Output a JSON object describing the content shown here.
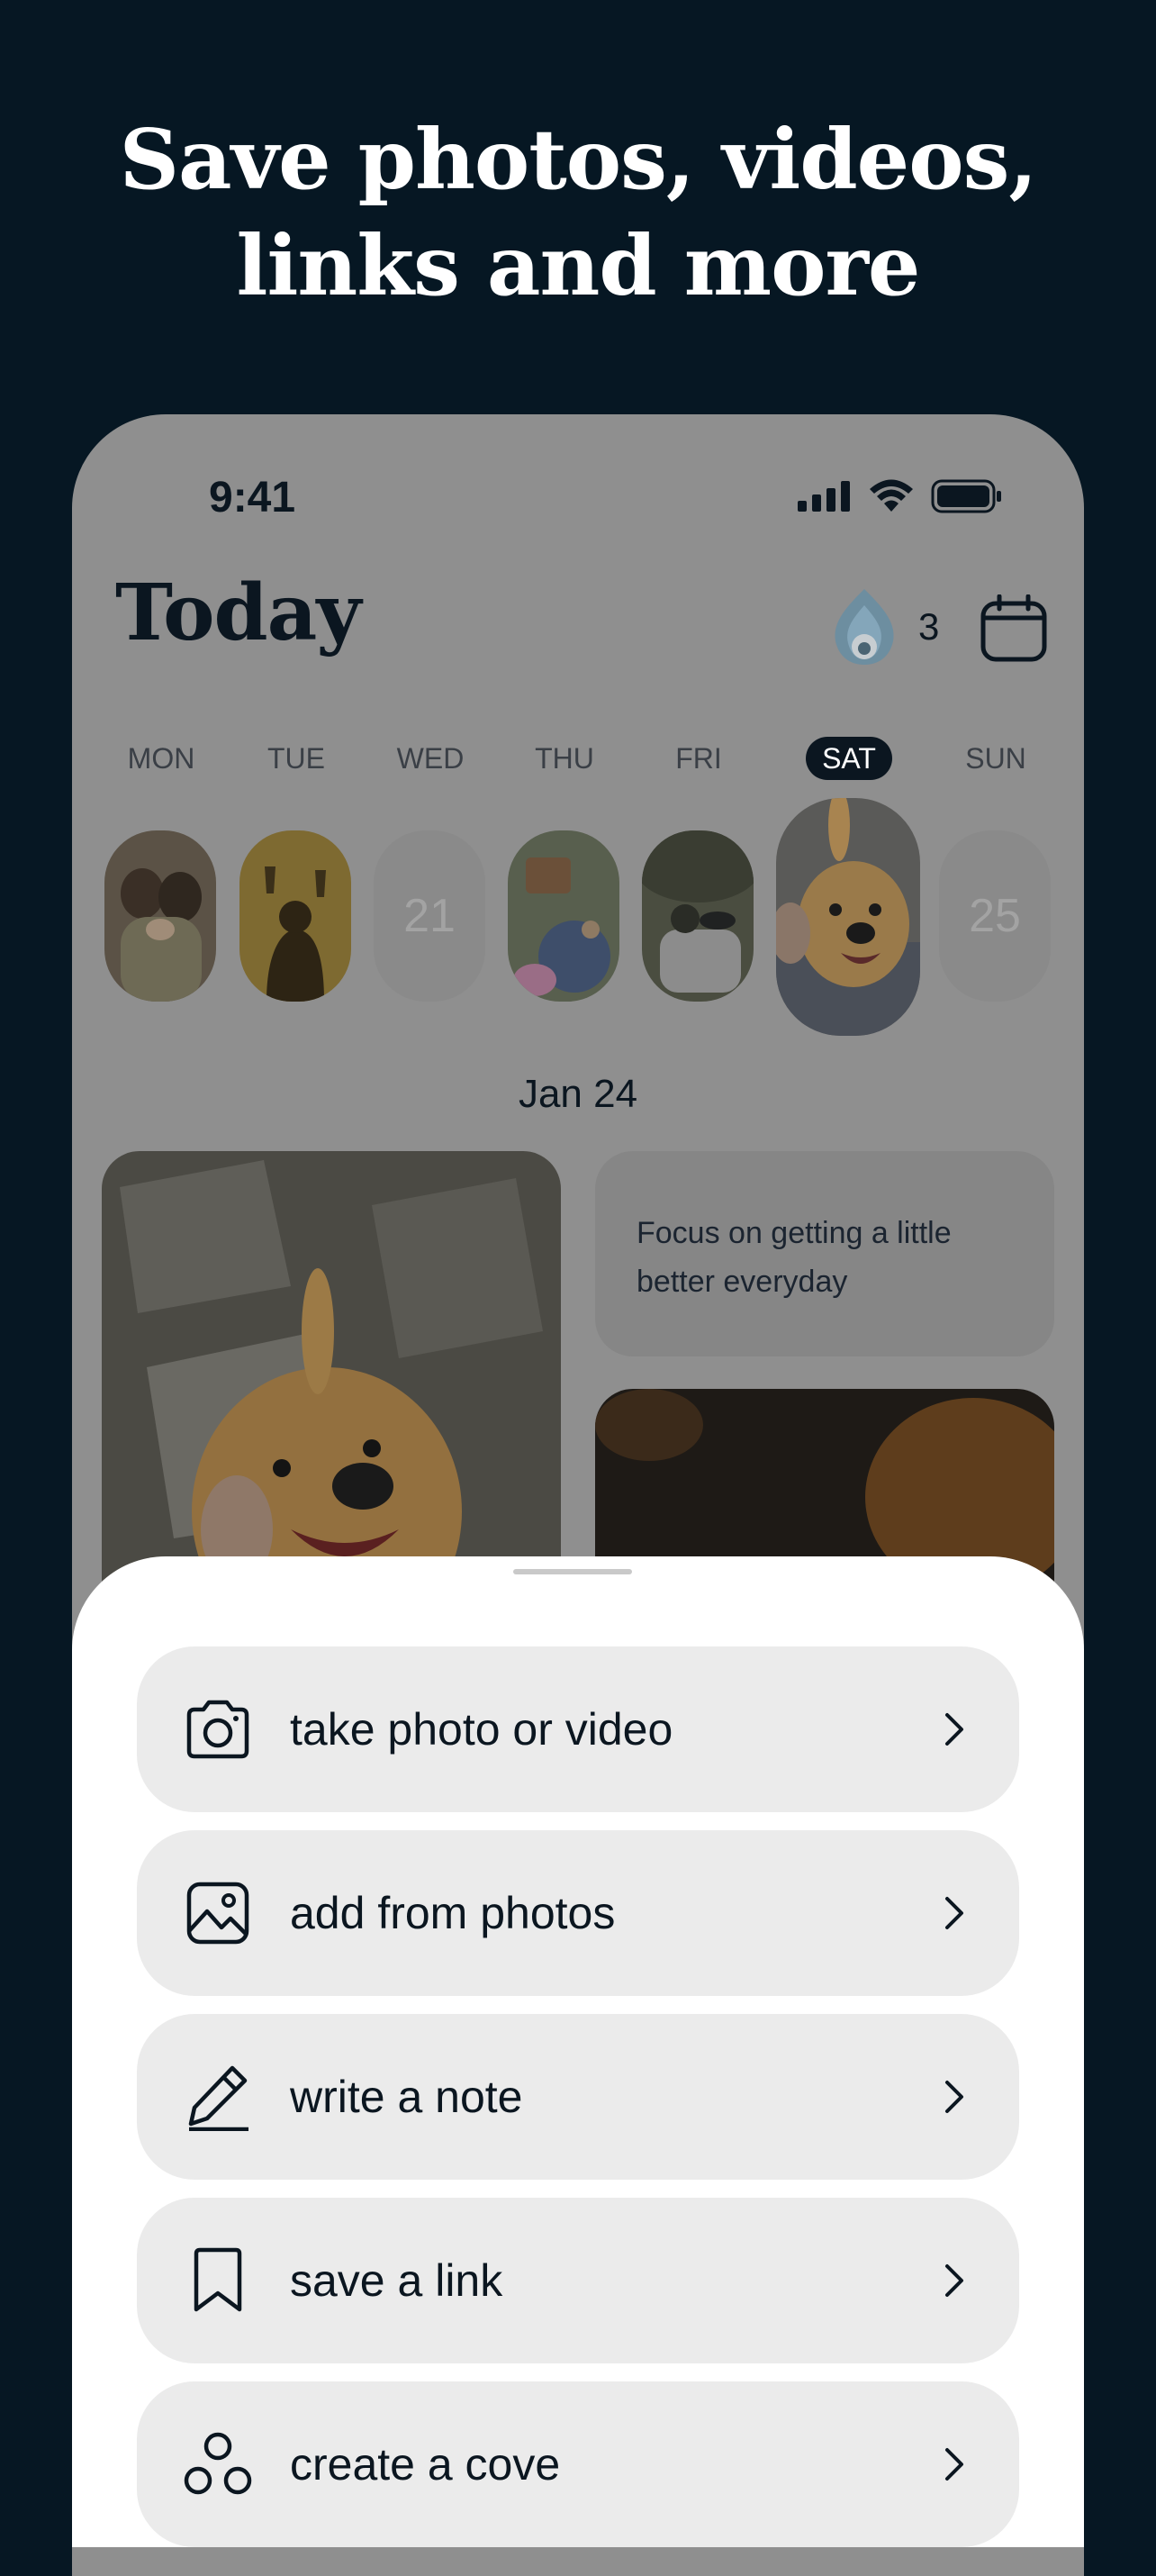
{
  "headline": {
    "line1": "Save photos, videos,",
    "line2": "links and more"
  },
  "status_bar": {
    "time": "9:41"
  },
  "header": {
    "title": "Today",
    "streak_count": "3"
  },
  "week": {
    "days": [
      {
        "label": "MON",
        "content": "photo"
      },
      {
        "label": "TUE",
        "content": "photo"
      },
      {
        "label": "WED",
        "content": "21"
      },
      {
        "label": "THU",
        "content": "photo"
      },
      {
        "label": "FRI",
        "content": "photo"
      },
      {
        "label": "SAT",
        "content": "photo",
        "selected": true
      },
      {
        "label": "SUN",
        "content": "25"
      }
    ]
  },
  "feed": {
    "date": "Jan 24",
    "note_text": "Focus on getting a little better everyday"
  },
  "sheet": {
    "options": [
      {
        "label": "take photo or video",
        "icon": "camera-icon"
      },
      {
        "label": "add from photos",
        "icon": "image-icon"
      },
      {
        "label": "write a note",
        "icon": "pencil-icon"
      },
      {
        "label": "save a link",
        "icon": "bookmark-icon"
      },
      {
        "label": "create a cove",
        "icon": "cove-icon"
      }
    ]
  },
  "colors": {
    "background": "#061723",
    "sheet": "#ffffff",
    "option_bg": "#ebebeb",
    "text": "#0b1620",
    "overlay": "#8f8f8f"
  }
}
